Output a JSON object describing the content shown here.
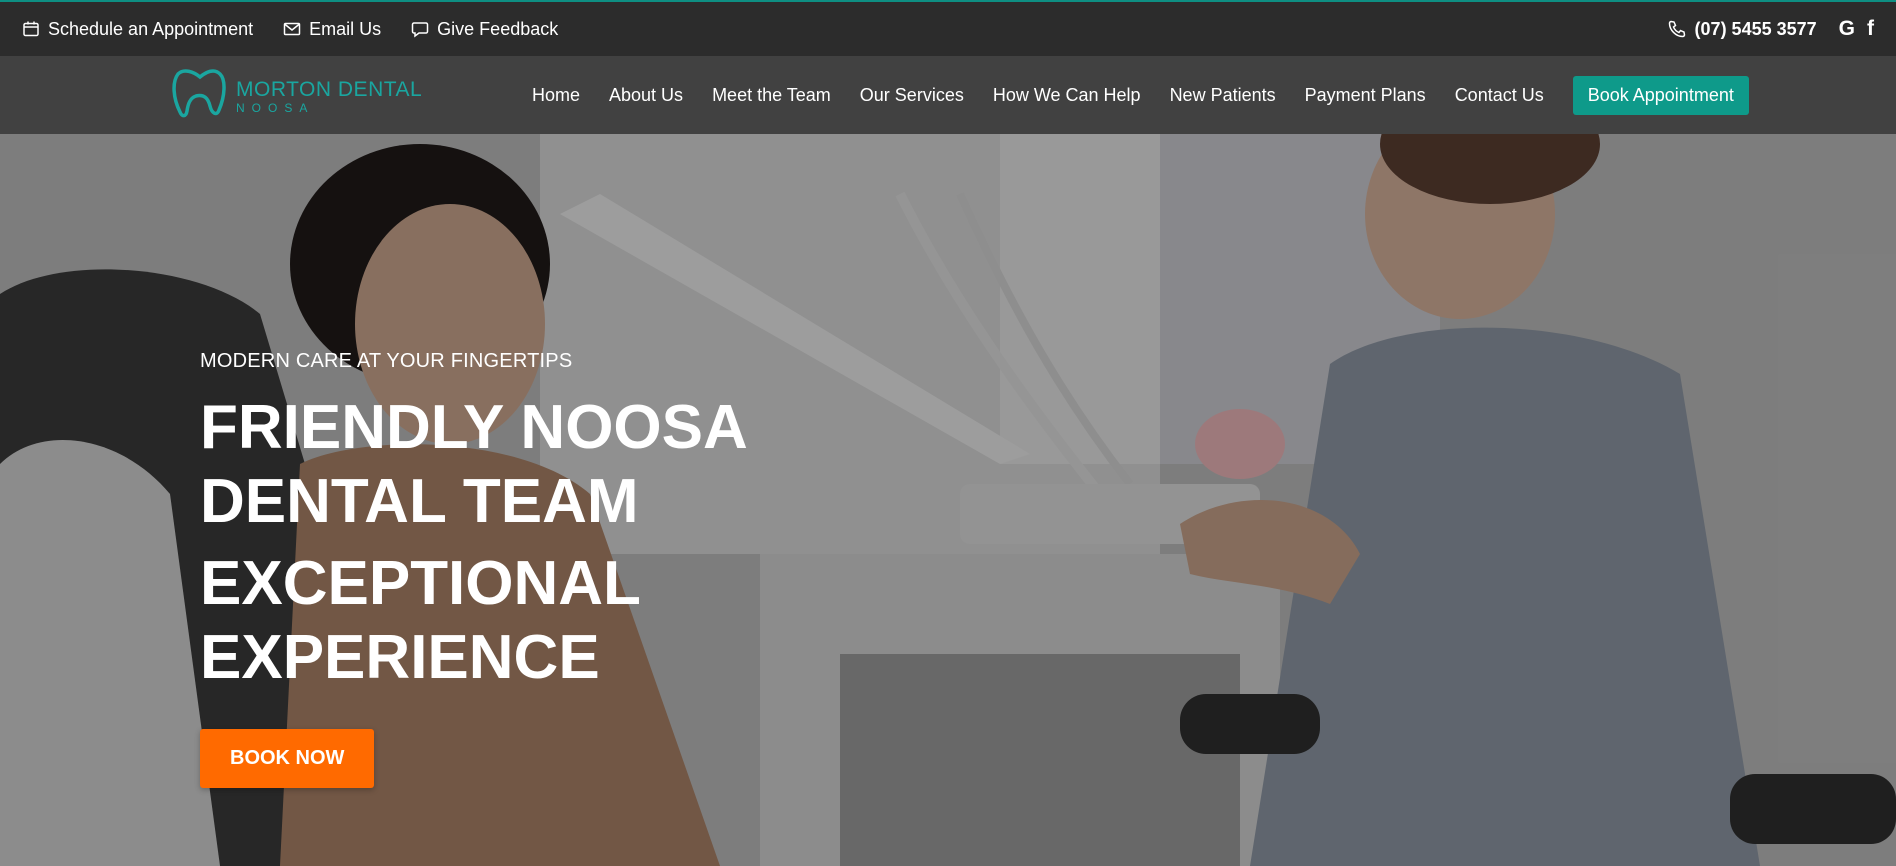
{
  "topbar": {
    "links": [
      {
        "label": "Schedule an Appointment",
        "icon": "calendar-icon"
      },
      {
        "label": "Email Us",
        "icon": "envelope-icon"
      },
      {
        "label": "Give Feedback",
        "icon": "chat-icon"
      }
    ],
    "phone": "(07) 5455 3577",
    "social": [
      "G",
      "f"
    ]
  },
  "logo": {
    "title": "MORTON DENTAL",
    "subtitle": "NOOSA"
  },
  "nav": {
    "items": [
      "Home",
      "About Us",
      "Meet the Team",
      "Our Services",
      "How We Can Help",
      "New Patients",
      "Payment Plans",
      "Contact Us"
    ],
    "cta": "Book Appointment"
  },
  "hero": {
    "eyebrow": "MODERN CARE AT YOUR FINGERTIPS",
    "headline_1": "FRIENDLY NOOSA DENTAL TEAM",
    "headline_2": "EXCEPTIONAL EXPERIENCE",
    "button": "BOOK NOW"
  },
  "colors": {
    "accent_teal": "#0e9a8a",
    "cta_orange": "#ff6a00",
    "topbar_bg": "#2c2c2c",
    "nav_bg": "#414141"
  }
}
